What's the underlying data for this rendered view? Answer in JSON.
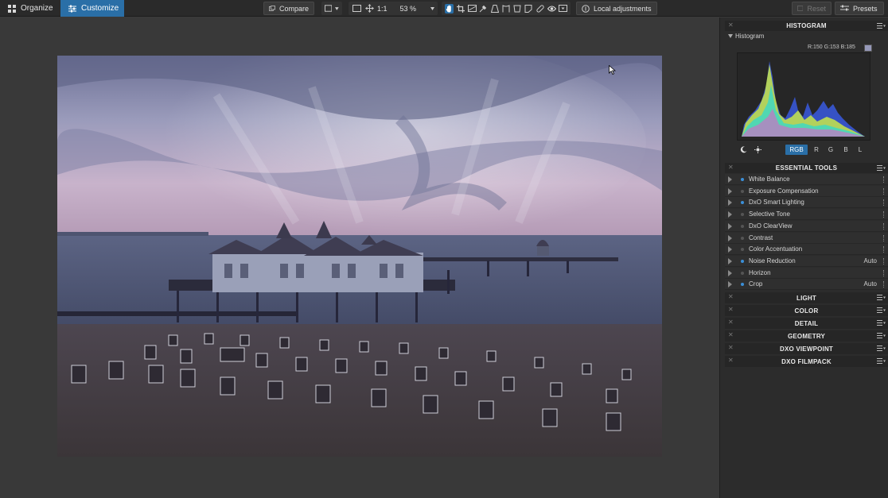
{
  "toolbar": {
    "tabs": [
      {
        "label": "Organize",
        "icon": "grid-icon"
      },
      {
        "label": "Customize",
        "icon": "sliders-icon"
      }
    ],
    "compare_label": "Compare",
    "one_to_one": "1:1",
    "zoom": "53 %",
    "local_adjustments_label": "Local adjustments",
    "reset_label": "Reset",
    "presets_label": "Presets",
    "accent_color": "#2a6fa7"
  },
  "histogram_panel": {
    "title": "HISTOGRAM",
    "subtitle": "Histogram",
    "readout": "R:150 G:153 B:185",
    "swatch_color": "#9699b9",
    "channels": [
      "RGB",
      "R",
      "G",
      "B",
      "L"
    ],
    "selected_channel": "RGB"
  },
  "essential_tools": {
    "title": "ESSENTIAL TOOLS",
    "items": [
      {
        "name": "White Balance",
        "value": "",
        "enabled": true
      },
      {
        "name": "Exposure Compensation",
        "value": "",
        "enabled": false
      },
      {
        "name": "DxO Smart Lighting",
        "value": "",
        "enabled": true
      },
      {
        "name": "Selective Tone",
        "value": "",
        "enabled": false
      },
      {
        "name": "DxO ClearView",
        "value": "",
        "enabled": false
      },
      {
        "name": "Contrast",
        "value": "",
        "enabled": false
      },
      {
        "name": "Color Accentuation",
        "value": "",
        "enabled": false
      },
      {
        "name": "Noise Reduction",
        "value": "Auto",
        "enabled": true
      },
      {
        "name": "Horizon",
        "value": "",
        "enabled": false
      },
      {
        "name": "Crop",
        "value": "Auto",
        "enabled": true
      }
    ]
  },
  "sections": [
    "LIGHT",
    "COLOR",
    "DETAIL",
    "GEOMETRY",
    "DXO VIEWPOINT",
    "DXO FILMPACK"
  ]
}
